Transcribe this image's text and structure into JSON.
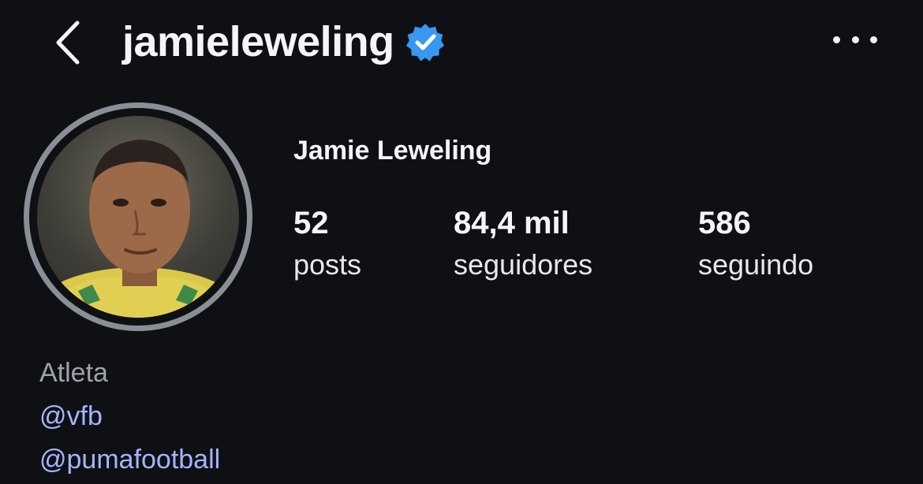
{
  "header": {
    "username": "jamieleweling",
    "verified": true,
    "accent_color": "#3897f0"
  },
  "icons": {
    "back": "chevron-left-icon",
    "verified": "verified-badge-icon",
    "more": "more-horizontal-icon"
  },
  "profile": {
    "display_name": "Jamie Leweling",
    "stats": [
      {
        "value": "52",
        "label": "posts"
      },
      {
        "value": "84,4 mil",
        "label": "seguidores"
      },
      {
        "value": "586",
        "label": "seguindo"
      }
    ]
  },
  "bio": {
    "category": "Atleta",
    "mentions": [
      "@vfb",
      "@pumafootball"
    ],
    "link_color": "#a5b4fc"
  }
}
